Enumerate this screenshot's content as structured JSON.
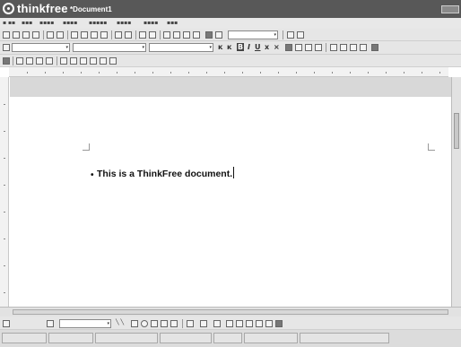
{
  "app": {
    "logo": "thinkfree",
    "document_title": "*Document1"
  },
  "document": {
    "text": "This is a ThinkFree document."
  },
  "icons": [
    "thinkfree-logo-icon",
    "bold-icon",
    "italic-icon",
    "underline-icon",
    "align-left-icon",
    "scroll-up-icon",
    "scroll-down-icon"
  ]
}
